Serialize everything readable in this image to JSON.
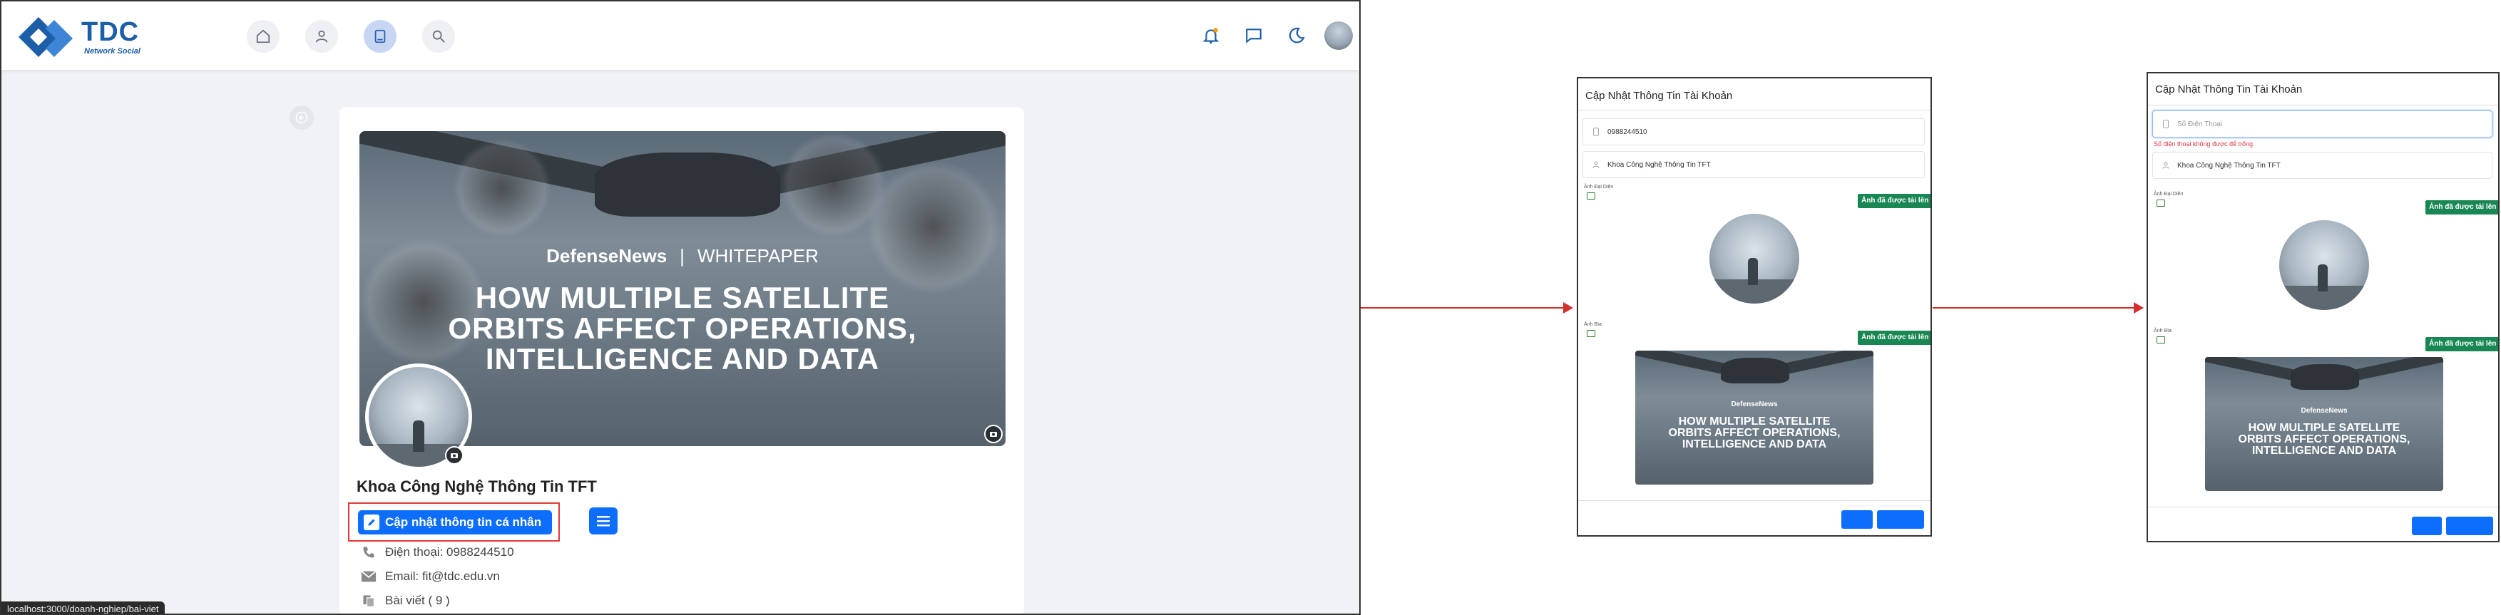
{
  "brand": {
    "logo_text": "TDC",
    "logo_sub": "Network Social",
    "logo_color": "#1c5fa8"
  },
  "nav": {
    "icons": [
      "home-icon",
      "user-icon",
      "book-icon",
      "search-icon"
    ],
    "active": "book-icon",
    "right_icons": [
      "bell-icon",
      "chat-icon",
      "moon-icon",
      "avatar"
    ]
  },
  "cover": {
    "brand_bold": "DefenseNews",
    "brand_sep": "|",
    "brand_light": "WHITEPAPER",
    "headline_1": "HOW MULTIPLE SATELLITE",
    "headline_2": "ORBITS AFFECT OPERATIONS,",
    "headline_3": "INTELLIGENCE AND DATA"
  },
  "profile": {
    "name": "Khoa Công Nghệ Thông Tin TFT",
    "update_button": "Cập nhật thông tin cá nhân",
    "phone": "Điện thoại: 0988244510",
    "email": "Email: fit@tdc.edu.vn",
    "posts": "Bài viết ( 9 )"
  },
  "status_url": "localhost:3000/doanh-nghiep/bai-viet",
  "colors": {
    "primary": "#0d6efd",
    "highlight": "#e53935",
    "arrow": "#d32f2f",
    "success": "#198754",
    "error": "#dc3545"
  },
  "modal1": {
    "title": "Cập Nhật Thông Tin Tài Khoản",
    "phone_value": "0988244510",
    "name_value": "Khoa Công Nghệ Thông Tin TFT",
    "avatar_label": "Ảnh Đại Diện",
    "avatar_badge": "Ảnh đã được tải lên",
    "cover_label": "Ảnh Bìa",
    "cover_badge": "Ảnh đã được tải lên"
  },
  "modal2": {
    "title": "Cập Nhật Thông Tin Tài Khoản",
    "phone_placeholder": "Số Điện Thoại",
    "phone_error": "Số điện thoại không được để trống",
    "name_value": "Khoa Công Nghệ Thông Tin TFT",
    "avatar_label": "Ảnh Đại Diện",
    "avatar_badge": "Ảnh đã được tải lên",
    "cover_label": "Ảnh Bìa",
    "cover_badge": "Ảnh đã được tải lên"
  }
}
